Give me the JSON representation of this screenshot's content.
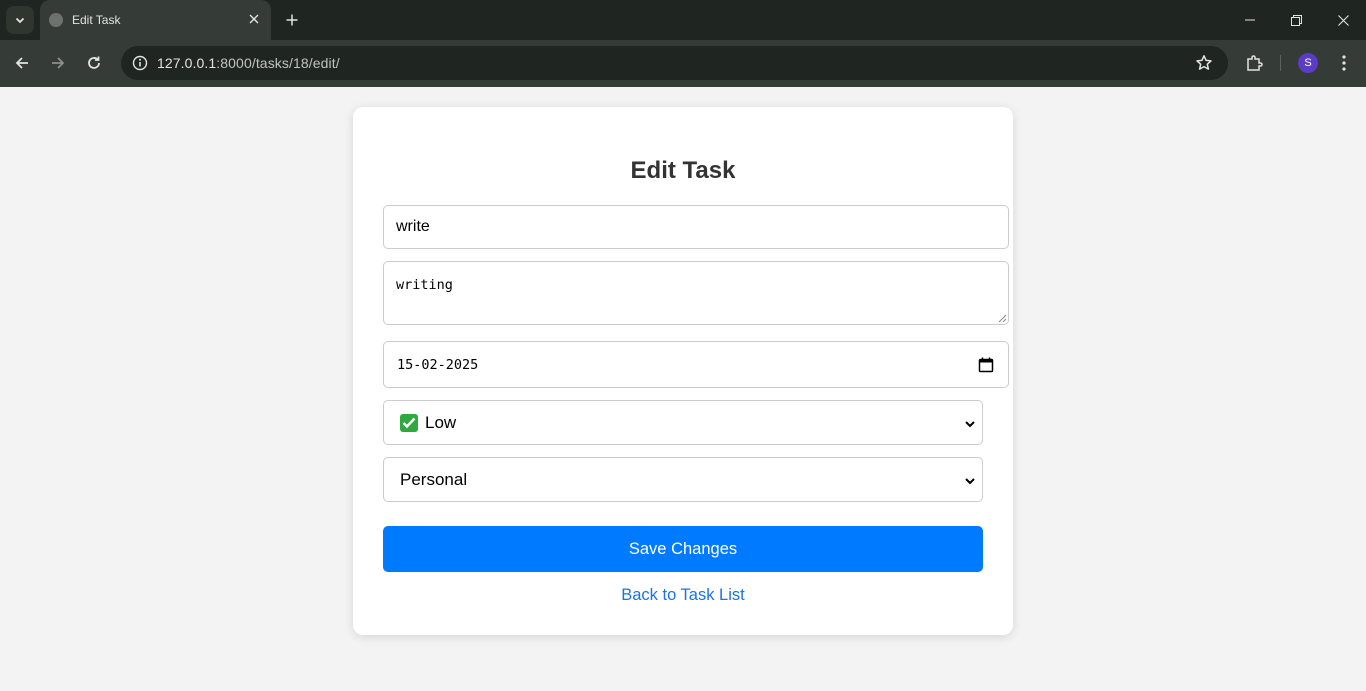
{
  "browser": {
    "tab_title": "Edit Task",
    "url_host": "127.0.0.1",
    "url_path": ":8000/tasks/18/edit/",
    "profile_initial": "S",
    "profile_color": "#5b3cc4"
  },
  "page": {
    "heading": "Edit Task",
    "title_value": "write",
    "description_value": "writing",
    "due_date_value": "15-02-2025",
    "priority_selected": "Low",
    "priority_icon": "white-check-mark-emoji",
    "category_selected": "Personal",
    "save_label": "Save Changes",
    "back_link_label": "Back to Task List",
    "accent_color": "#007bff"
  }
}
